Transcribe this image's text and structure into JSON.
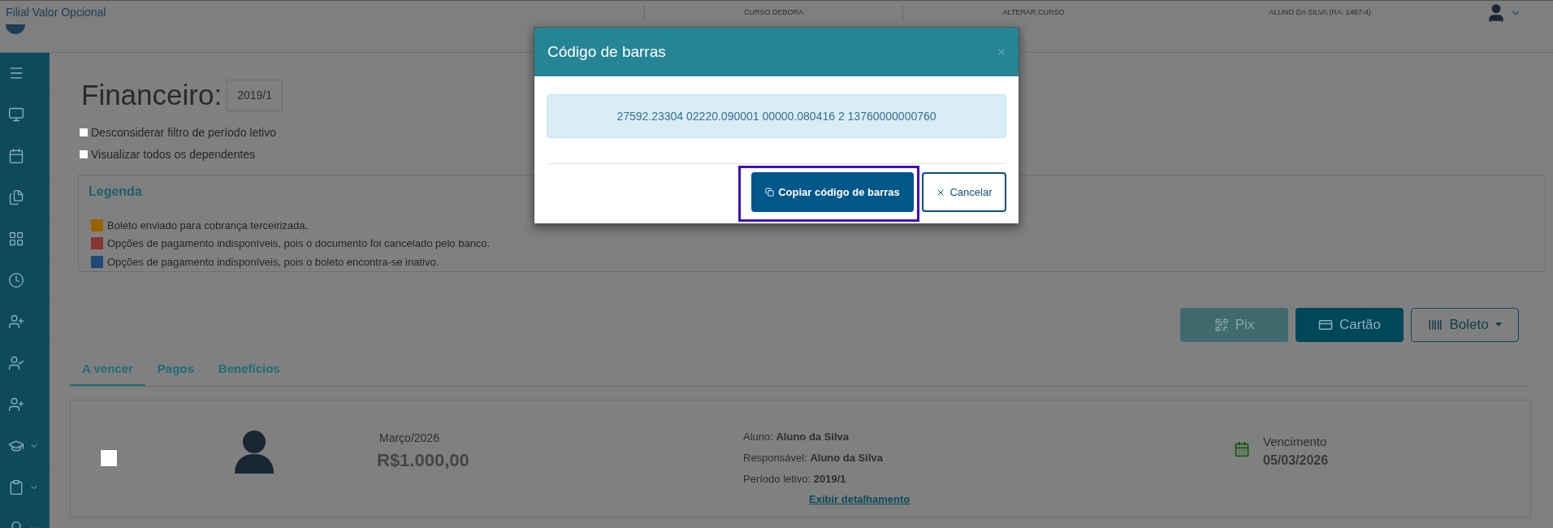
{
  "top_bar": {
    "title": "Filial Valor Opcional",
    "items": [
      "CURSO DEBORA",
      "ALTERAR CURSO",
      "ALUNO DA SILVA (RA: 1487-4)"
    ]
  },
  "sidebar": {
    "items": [
      {
        "kind": "menu",
        "expandable": false
      },
      {
        "kind": "monitor",
        "expandable": false
      },
      {
        "kind": "calendar",
        "expandable": false
      },
      {
        "kind": "files",
        "expandable": false
      },
      {
        "kind": "grid",
        "expandable": false
      },
      {
        "kind": "clock",
        "expandable": false
      },
      {
        "kind": "user-plus",
        "expandable": false
      },
      {
        "kind": "user-check",
        "expandable": false
      },
      {
        "kind": "user-plus",
        "expandable": false
      },
      {
        "kind": "graduation",
        "expandable": true
      },
      {
        "kind": "clipboard",
        "expandable": true
      },
      {
        "kind": "lightbulb",
        "expandable": true
      }
    ]
  },
  "page": {
    "title": "Financeiro:",
    "period": "2019/1"
  },
  "filters": [
    {
      "label": "Desconsiderar filtro de período letivo",
      "checked": false
    },
    {
      "label": "Visualizar todos os dependentes",
      "checked": false
    }
  ],
  "legend": {
    "title": "Legenda",
    "items": [
      {
        "label": "Boleto enviado para cobrança terceirizada.",
        "color": "#9a6100"
      },
      {
        "label": "Opções de pagamento indisponíveis, pois o documento foi cancelado pelo banco.",
        "color": "#8a3333"
      },
      {
        "label": "Opções de pagamento indisponíveis, pois o boleto encontra-se inativo.",
        "color": "#1f4a78"
      }
    ]
  },
  "payment_buttons": [
    {
      "kind": "pix",
      "label": "Pix",
      "disabled": true
    },
    {
      "kind": "card",
      "label": "Cartão",
      "disabled": false
    },
    {
      "kind": "boleto",
      "label": "Boleto",
      "disabled": false
    }
  ],
  "tabs": [
    {
      "label": "A vencer",
      "selected": true
    },
    {
      "label": "Pagos",
      "selected": false
    },
    {
      "label": "Benefícios",
      "selected": false
    }
  ],
  "bills": [
    {
      "checked": false,
      "month": "Março/2026",
      "amount": "R$1.000,00",
      "details": [
        "Aluno: **Aluno da Silva**",
        "Responsável: **Aluno da Silva**",
        "Período letivo: **2019/1**"
      ],
      "link": "Exibir detalhamento",
      "due_label": "Vencimento",
      "due_date": "05/03/2026"
    }
  ],
  "modal": {
    "title": "Código de barras",
    "code": "27592.23304 02220.090001 00000.080416 2 13760000000760",
    "buttons": [
      {
        "kind": "primary",
        "label": "Copiar código de barras",
        "highlighted": true
      },
      {
        "kind": "cancel",
        "label": "Cancelar",
        "highlighted": false
      }
    ]
  }
}
